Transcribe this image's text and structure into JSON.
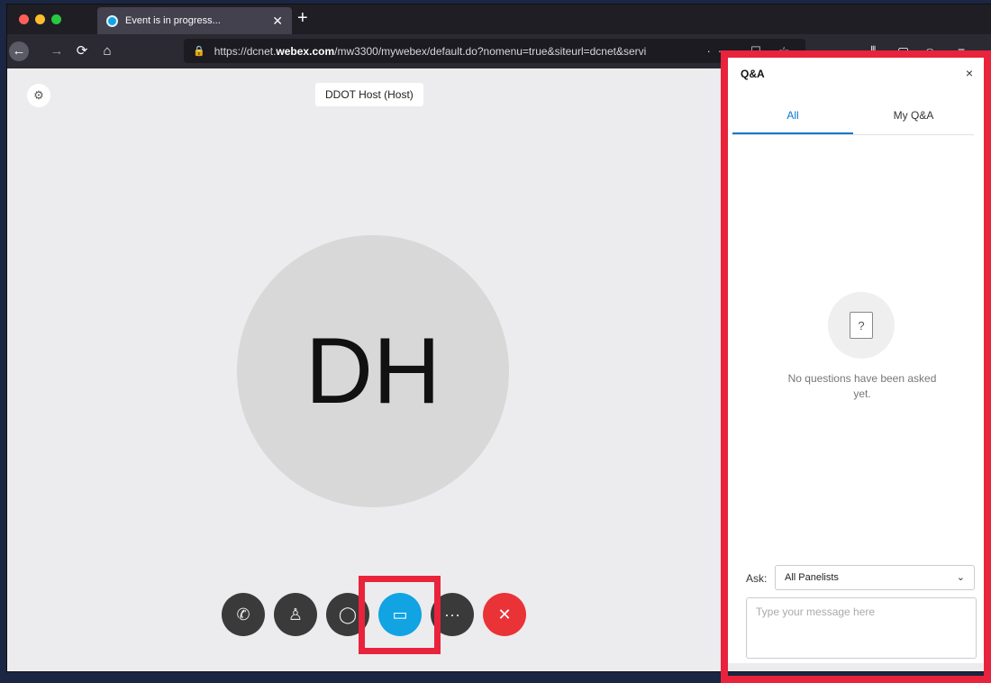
{
  "browser": {
    "tab_title": "Event is in progress...",
    "tab_close": "✕",
    "new_tab": "+",
    "nav": {
      "back": "←",
      "forward": "→",
      "reload": "⟳",
      "home": "⌂"
    },
    "url_prefix": "https://dcnet.",
    "url_domain": "webex.com",
    "url_rest": "/mw3300/mywebex/default.do?nomenu=true&siteurl=dcnet&servi",
    "url_actions": "··· ☐ ☆",
    "right_icons": [
      "⫼",
      "▢",
      "☺",
      "≡"
    ]
  },
  "meeting": {
    "settings_icon": "⚙",
    "host_label": "DDOT Host (Host)",
    "avatar_initials": "DH",
    "controls": [
      "✆",
      "♙",
      "◯",
      "▭",
      "···",
      "✕"
    ]
  },
  "qa": {
    "title": "Q&A",
    "close": "×",
    "tabs": [
      "All",
      "My Q&A"
    ],
    "active_tab": "All",
    "empty_icon": "?",
    "empty_text": "No questions have been asked yet.",
    "ask_label": "Ask:",
    "ask_value": "All Panelists",
    "ask_chevron": "⌄",
    "message_placeholder": "Type your message here"
  },
  "colors": {
    "highlight": "#e8233b",
    "active_control": "#12a3e3",
    "end_control": "#ea3337",
    "active_tab": "#0a78cc"
  }
}
